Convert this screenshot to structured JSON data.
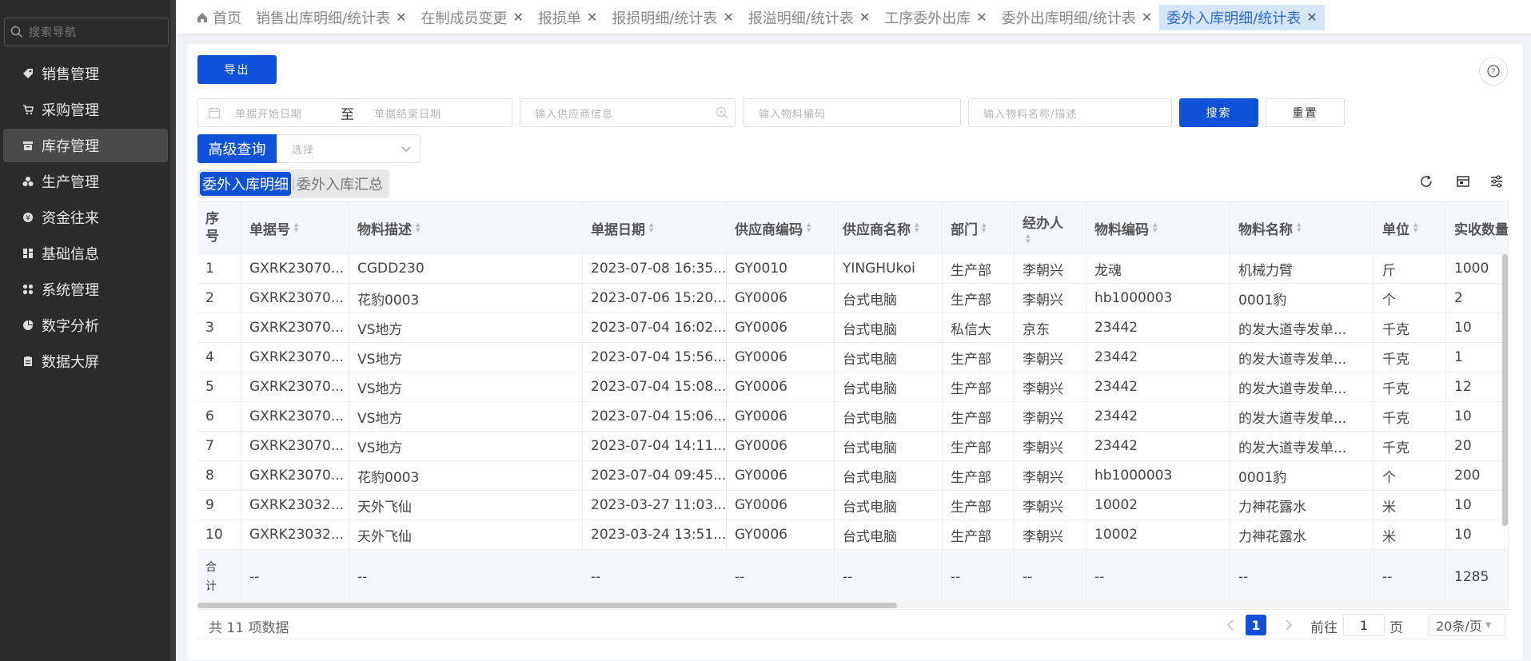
{
  "sidebar": {
    "search_placeholder": "搜索导航",
    "items": [
      {
        "label": "销售管理",
        "icon": "tag-icon"
      },
      {
        "label": "采购管理",
        "icon": "cart-icon"
      },
      {
        "label": "库存管理",
        "icon": "archive-icon"
      },
      {
        "label": "生产管理",
        "icon": "production-icon"
      },
      {
        "label": "资金往来",
        "icon": "money-icon"
      },
      {
        "label": "基础信息",
        "icon": "grid-icon"
      },
      {
        "label": "系统管理",
        "icon": "modules-icon"
      },
      {
        "label": "数字分析",
        "icon": "pie-icon"
      },
      {
        "label": "数据大屏",
        "icon": "clipboard-icon"
      }
    ],
    "active_index": 2
  },
  "tabs": [
    {
      "label": "首页",
      "closable": false
    },
    {
      "label": "销售出库明细/统计表",
      "closable": true
    },
    {
      "label": "在制成员变更",
      "closable": true
    },
    {
      "label": "报损单",
      "closable": true
    },
    {
      "label": "报损明细/统计表",
      "closable": true
    },
    {
      "label": "报溢明细/统计表",
      "closable": true
    },
    {
      "label": "工序委外出库",
      "closable": true
    },
    {
      "label": "委外出库明细/统计表",
      "closable": true
    },
    {
      "label": "委外入库明细/统计表",
      "closable": true,
      "active": true
    }
  ],
  "toolbar": {
    "export_label": "导出",
    "help_icon": "help-icon"
  },
  "filters": {
    "start_date_placeholder": "单据开始日期",
    "date_separator": "至",
    "end_date_placeholder": "单据结束日期",
    "supplier_placeholder": "输入供应商信息",
    "material_code_placeholder": "输入物料编码",
    "material_name_placeholder": "输入物料名称/描述",
    "search_label": "搜索",
    "reset_label": "重置",
    "advanced_label": "高级查询",
    "select_placeholder": "选择"
  },
  "subtabs": [
    {
      "label": "委外入库明细",
      "active": true
    },
    {
      "label": "委外入库汇总",
      "active": false
    }
  ],
  "table": {
    "columns": [
      {
        "label": "序号",
        "sortable": false
      },
      {
        "label": "单据号",
        "sortable": true
      },
      {
        "label": "物料描述",
        "sortable": true
      },
      {
        "label": "单据日期",
        "sortable": true
      },
      {
        "label": "供应商编码",
        "sortable": true
      },
      {
        "label": "供应商名称",
        "sortable": true
      },
      {
        "label": "部门",
        "sortable": true
      },
      {
        "label": "经办人",
        "sortable": true
      },
      {
        "label": "物料编码",
        "sortable": true
      },
      {
        "label": "物料名称",
        "sortable": true
      },
      {
        "label": "单位",
        "sortable": true
      },
      {
        "label": "实收数量",
        "sortable": false
      }
    ],
    "rows": [
      [
        "1",
        "GXRK23070...",
        "CGDD230",
        "2023-07-08 16:35...",
        "GY0010",
        "YINGHUkoi",
        "生产部",
        "李朝兴",
        "龙魂",
        "机械力臂",
        "斤",
        "1000"
      ],
      [
        "2",
        "GXRK23070...",
        "花豹0003",
        "2023-07-06 15:20...",
        "GY0006",
        "台式电脑",
        "生产部",
        "李朝兴",
        "hb1000003",
        "0001豹",
        "个",
        "2"
      ],
      [
        "3",
        "GXRK23070...",
        "VS地方",
        "2023-07-04 16:02...",
        "GY0006",
        "台式电脑",
        "私信大",
        "京东",
        "23442",
        "的发大道寺发单...",
        "千克",
        "10"
      ],
      [
        "4",
        "GXRK23070...",
        "VS地方",
        "2023-07-04 15:56...",
        "GY0006",
        "台式电脑",
        "生产部",
        "李朝兴",
        "23442",
        "的发大道寺发单...",
        "千克",
        "1"
      ],
      [
        "5",
        "GXRK23070...",
        "VS地方",
        "2023-07-04 15:08...",
        "GY0006",
        "台式电脑",
        "生产部",
        "李朝兴",
        "23442",
        "的发大道寺发单...",
        "千克",
        "12"
      ],
      [
        "6",
        "GXRK23070...",
        "VS地方",
        "2023-07-04 15:06...",
        "GY0006",
        "台式电脑",
        "生产部",
        "李朝兴",
        "23442",
        "的发大道寺发单...",
        "千克",
        "10"
      ],
      [
        "7",
        "GXRK23070...",
        "VS地方",
        "2023-07-04 14:11...",
        "GY0006",
        "台式电脑",
        "生产部",
        "李朝兴",
        "23442",
        "的发大道寺发单...",
        "千克",
        "20"
      ],
      [
        "8",
        "GXRK23070...",
        "花豹0003",
        "2023-07-04 09:45...",
        "GY0006",
        "台式电脑",
        "生产部",
        "李朝兴",
        "hb1000003",
        "0001豹",
        "个",
        "200"
      ],
      [
        "9",
        "GXRK23032...",
        "天外飞仙",
        "2023-03-27 11:03...",
        "GY0006",
        "台式电脑",
        "生产部",
        "李朝兴",
        "10002",
        "力神花露水",
        "米",
        "10"
      ],
      [
        "10",
        "GXRK23032...",
        "天外飞仙",
        "2023-03-24 13:51...",
        "GY0006",
        "台式电脑",
        "生产部",
        "李朝兴",
        "10002",
        "力神花露水",
        "米",
        "10"
      ]
    ],
    "summary": [
      "合计",
      "--",
      "--",
      "--",
      "--",
      "--",
      "--",
      "--",
      "--",
      "--",
      "--",
      "1285"
    ]
  },
  "pagination": {
    "total_text": "共 11 项数据",
    "current_page": "1",
    "goto_prefix": "前往",
    "goto_value": "1",
    "goto_suffix": "页",
    "page_size": "20条/页"
  },
  "colors": {
    "primary": "#0f52d9",
    "sidebar_bg": "#2b2b2b",
    "active_tab_bg": "#d6e6f9"
  }
}
